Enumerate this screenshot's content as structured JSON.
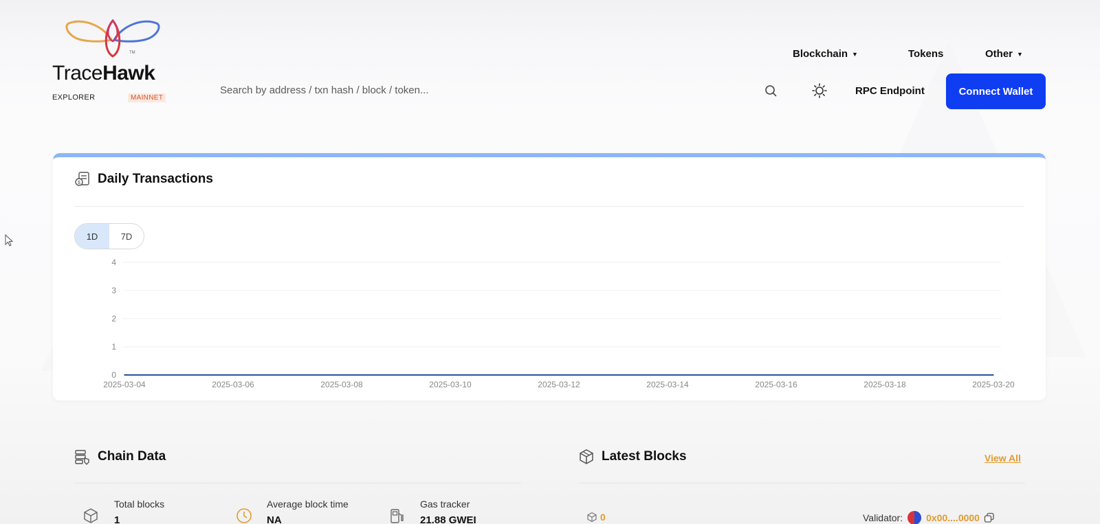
{
  "brand": {
    "name_light": "Trace",
    "name_bold": "Hawk",
    "tm": "TM",
    "subtitle": "EXPLORER",
    "network": "MAINNET"
  },
  "search": {
    "placeholder": "Search by address / txn hash / block / token..."
  },
  "nav": {
    "items": [
      {
        "label": "Blockchain",
        "has_dropdown": true
      },
      {
        "label": "Tokens",
        "has_dropdown": false
      },
      {
        "label": "Other",
        "has_dropdown": true
      }
    ],
    "caret": "▼",
    "rpc_label": "RPC Endpoint",
    "connect_label": "Connect Wallet"
  },
  "daily": {
    "title": "Daily Transactions",
    "toggles": [
      {
        "label": "1D",
        "active": true
      },
      {
        "label": "7D",
        "active": false
      }
    ]
  },
  "chart_data": {
    "type": "area",
    "title": "Daily Transactions",
    "x": [
      "2025-03-04",
      "2025-03-05",
      "2025-03-06",
      "2025-03-07",
      "2025-03-08",
      "2025-03-09",
      "2025-03-10",
      "2025-03-11",
      "2025-03-12",
      "2025-03-13",
      "2025-03-14",
      "2025-03-15",
      "2025-03-16",
      "2025-03-17",
      "2025-03-18",
      "2025-03-19",
      "2025-03-20"
    ],
    "x_tick_labels": [
      "2025-03-04",
      "2025-03-06",
      "2025-03-08",
      "2025-03-10",
      "2025-03-12",
      "2025-03-14",
      "2025-03-16",
      "2025-03-18",
      "2025-03-20"
    ],
    "series": [
      {
        "values": [
          0,
          0,
          0,
          0,
          0,
          0,
          0,
          0,
          0,
          0,
          0,
          0,
          0,
          0,
          0,
          0,
          0
        ]
      }
    ],
    "y_ticks": [
      0,
      1,
      2,
      3,
      4
    ],
    "ylim": [
      0,
      4
    ],
    "xlabel": "",
    "ylabel": "",
    "grid": true,
    "line_color": "#2a4f9e"
  },
  "chain": {
    "title": "Chain Data",
    "stats": [
      {
        "label": "Total blocks",
        "value": "1"
      },
      {
        "label": "Average block time",
        "value": "NA"
      },
      {
        "label": "Gas tracker",
        "value": "21.88 GWEI"
      }
    ]
  },
  "blocks": {
    "title": "Latest Blocks",
    "view_all": "View All",
    "rows": [
      {
        "number": "0",
        "validator_label": "Validator:",
        "validator_addr": "0x00....0000"
      }
    ]
  },
  "colors": {
    "accent": "#0f3df2",
    "link": "#e29b2e",
    "card_top": "#8db6f4",
    "toggle_active": "#d9e7fb"
  }
}
